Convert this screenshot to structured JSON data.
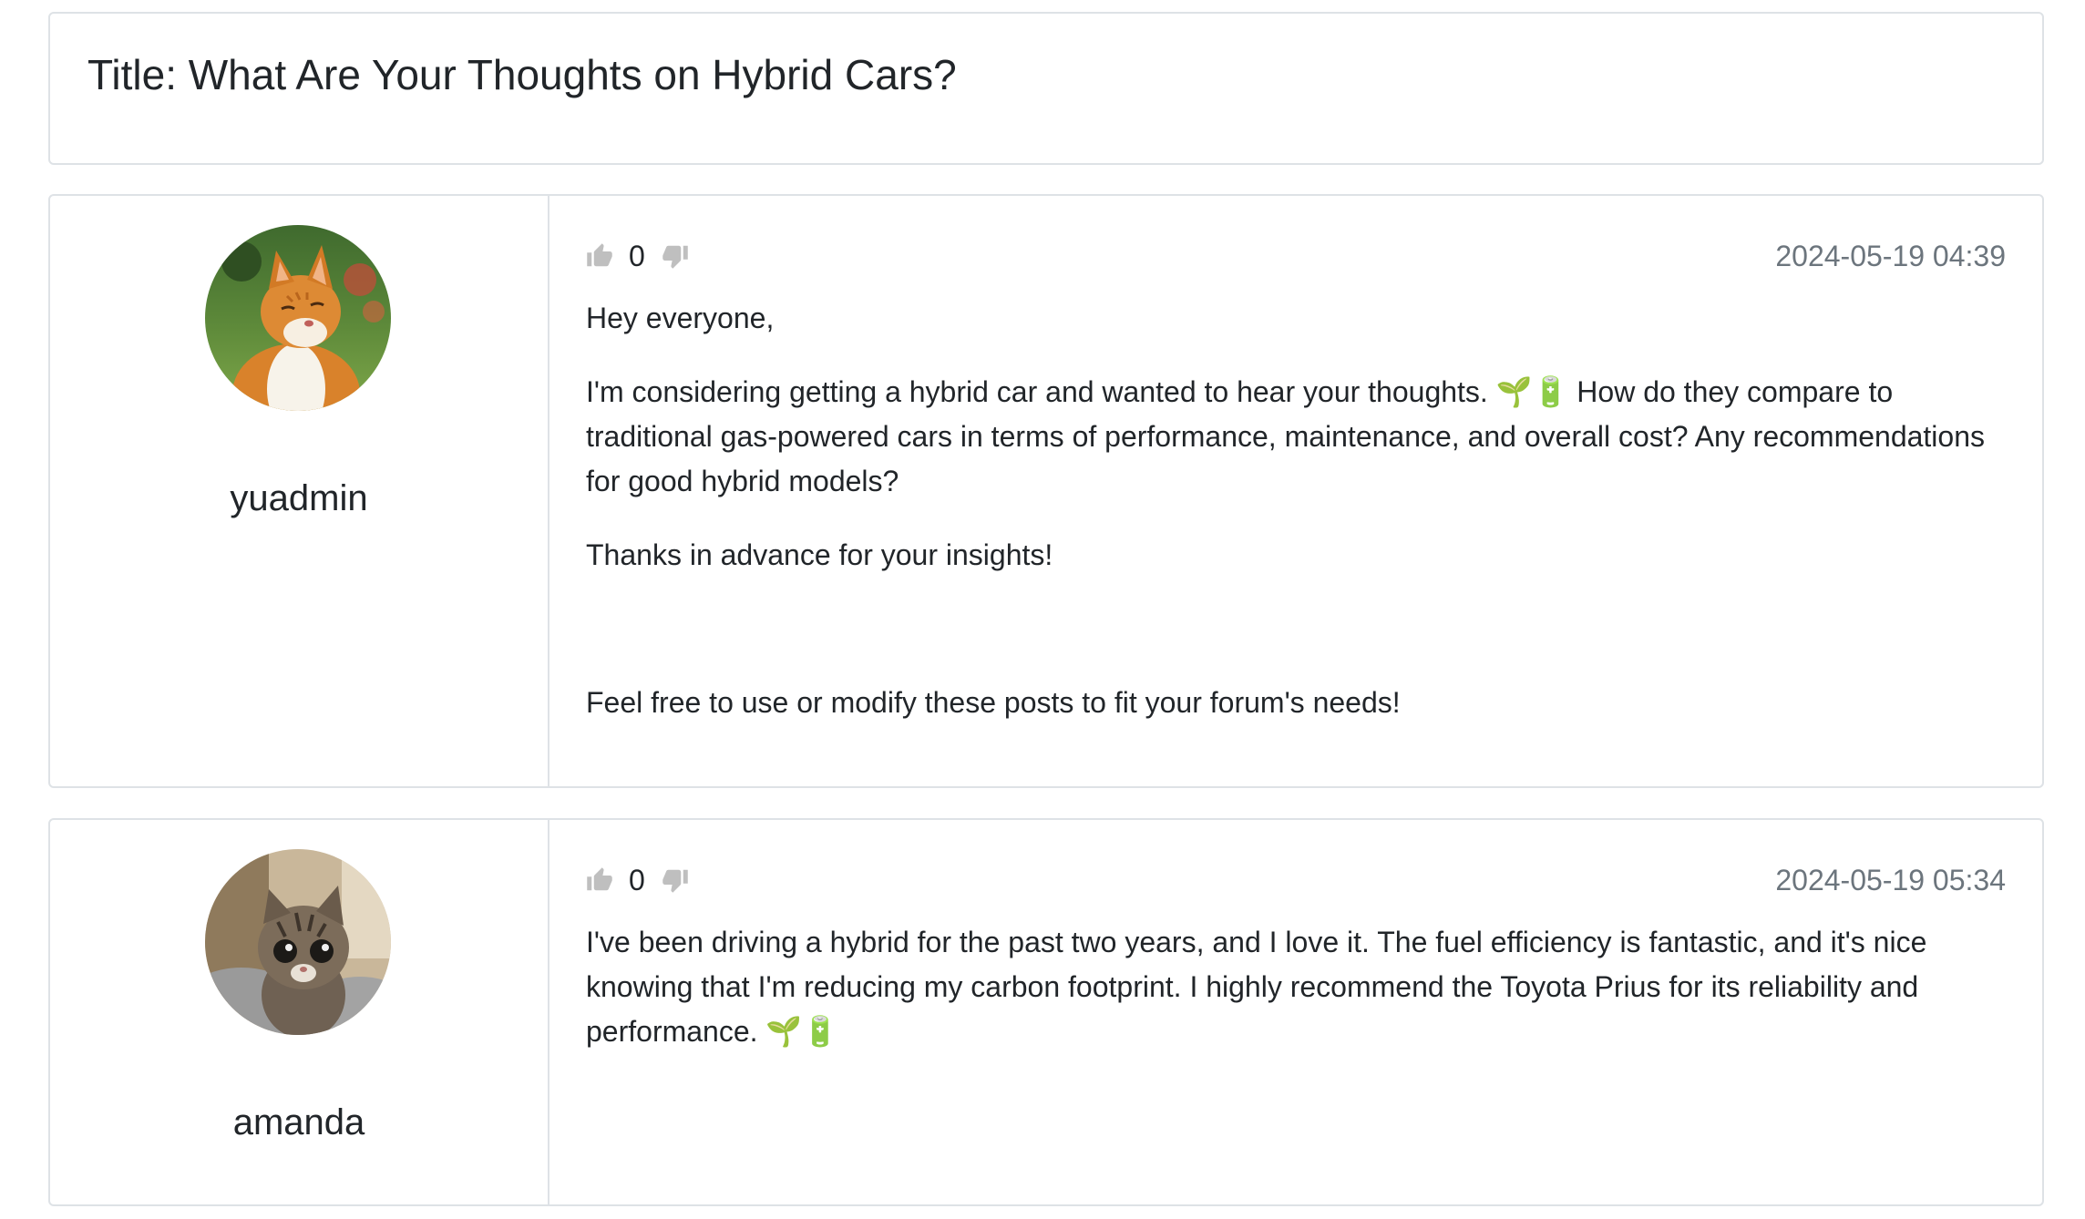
{
  "thread": {
    "title": "Title: What Are Your Thoughts on Hybrid Cars?"
  },
  "posts": [
    {
      "username": "yuadmin",
      "avatar_icon": "orange-tabby-cat-avatar",
      "votes": "0",
      "timestamp": "2024-05-19 04:39",
      "paragraphs": [
        "Hey everyone,",
        "I'm considering getting a hybrid car and wanted to hear your thoughts. 🌱🔋 How do they compare to traditional gas-powered cars in terms of performance, maintenance, and overall cost? Any recommendations for good hybrid models?",
        "Thanks in advance for your insights!",
        "Feel free to use or modify these posts to fit your forum's needs!"
      ]
    },
    {
      "username": "amanda",
      "avatar_icon": "tabby-kitten-avatar",
      "votes": "0",
      "timestamp": "2024-05-19 05:34",
      "paragraphs": [
        "I've been driving a hybrid for the past two years, and I love it. The fuel efficiency is fantastic, and it's nice knowing that I'm reducing my carbon footprint. I highly recommend the Toyota Prius for its reliability and performance. 🌱🔋"
      ]
    }
  ],
  "icons": {
    "upvote": "thumbs-up-icon",
    "downvote": "thumbs-down-icon"
  },
  "colors": {
    "border": "#dee2e6",
    "muted_text": "#6c757d",
    "vote_icon": "#bfbfbf",
    "text": "#212529"
  }
}
